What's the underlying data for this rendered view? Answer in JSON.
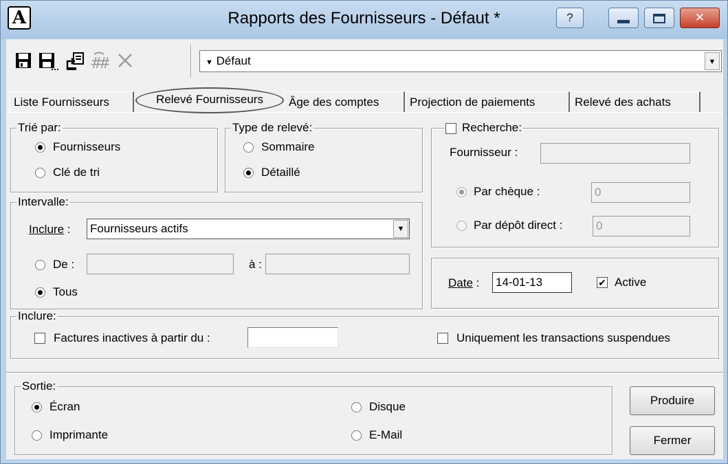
{
  "window": {
    "app_icon": "A",
    "title": "Rapports des Fournisseurs - Défaut *",
    "help_glyph": "?",
    "close_glyph": "✕"
  },
  "toolbar": {
    "icons": [
      "save-icon",
      "save-as-icon",
      "export-icon",
      "renumber-icon",
      "delete-icon"
    ],
    "report_combo_value": "Défaut",
    "report_combo_marker": "▼",
    "dropdown_glyph": "▼"
  },
  "tabs": [
    {
      "label": "Liste Fournisseurs"
    },
    {
      "label": "Relevé Fournisseurs"
    },
    {
      "label": "Âge des comptes"
    },
    {
      "label": "Projection de paiements"
    },
    {
      "label": "Relevé des achats"
    }
  ],
  "sort": {
    "legend": "Trié par:",
    "options": [
      "Fournisseurs",
      "Clé de tri"
    ],
    "selected": 0
  },
  "statement_type": {
    "legend": "Type de relevé:",
    "options": [
      "Sommaire",
      "Détaillé"
    ],
    "selected": 1
  },
  "search": {
    "legend": "Recherche:",
    "checked": false,
    "supplier_label": "Fournisseur :",
    "supplier_value": "",
    "by_cheque_label": "Par chèque :",
    "by_cheque_value": "0",
    "by_direct_deposit_label": "Par dépôt direct :",
    "by_direct_deposit_value": "0"
  },
  "range": {
    "legend": "Intervalle:",
    "include_label": "Inclure",
    "include_colon": " :",
    "include_value": "Fournisseurs actifs",
    "from_label": "De :",
    "from_value": "",
    "to_label": "à :",
    "to_value": "",
    "all_label": "Tous",
    "selected": "all"
  },
  "date": {
    "label": "Date",
    "colon": " :",
    "value": "14-01-13",
    "active_label": "Active",
    "active_checked": true,
    "check_glyph": "✔"
  },
  "include": {
    "legend": "Inclure:",
    "inactive_invoices_label": "Factures inactives à partir du :",
    "inactive_invoices_checked": false,
    "inactive_invoices_value": "",
    "suspended_only_label": "Uniquement les transactions suspendues",
    "suspended_only_checked": false
  },
  "output": {
    "legend": "Sortie:",
    "options": [
      "Écran",
      "Imprimante",
      "Disque",
      "E-Mail"
    ],
    "selected": "Écran"
  },
  "buttons": {
    "produce": "Produire",
    "close": "Fermer"
  }
}
